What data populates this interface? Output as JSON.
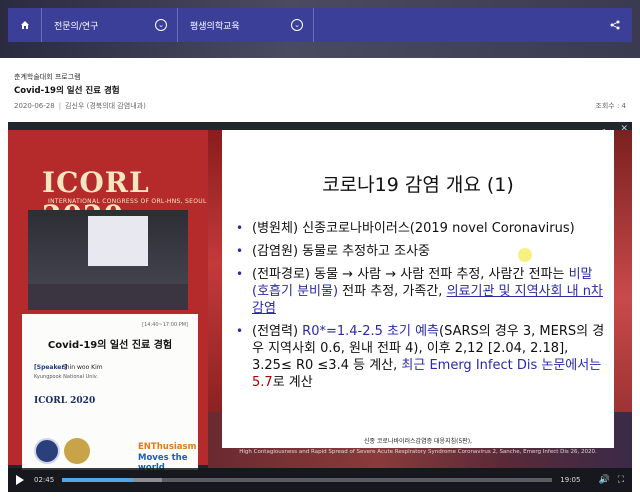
{
  "nav": {
    "home_icon": "home-icon",
    "menu1": "전문의/연구",
    "menu2": "평생의학교육",
    "share_icon": "share-icon",
    "bg_color": "#3b3f97"
  },
  "post": {
    "category": "춘계학술대회 프로그램",
    "title": "Covid-19의 일선 진료 경험",
    "date": "2020-06-28",
    "author": "김신우 (경북의대 감염내과)",
    "views_label": "조회수 : 4"
  },
  "video": {
    "current_time": "02:45",
    "duration": "19:05",
    "progress": 0.144,
    "buffered": 0.06,
    "left_panel": {
      "brand": "ICORL 2020",
      "brand_sub": "INTERNATIONAL CONGRESS OF ORL-HNS, SEOUL",
      "time": "[14:40~17:00 PM]",
      "talk_title": "Covid-19의 일선 진료 경험",
      "speaker_role": "[Speaker]",
      "speaker_name": "Shin woo Kim",
      "speaker_org": "Kyungpook National Univ.",
      "small_logo": "ICORL 2020",
      "tagline1": "ENThusiasm",
      "tagline2": "Moves the world"
    },
    "slide": {
      "heading": "코로나19 감염 개요 (1)",
      "b1_a": "(병원체) 신종코로나바이러스(2019 novel Coronavirus)",
      "b2_a": "(감염원) 동물로 추정하고 조사중",
      "b3_a": "(전파경로) 동물 → 사람 → 사람 전파 추정, 사람간 전파는 ",
      "b3_b": "비말(호흡기 분비물)",
      "b3_c": " 전파 추정, 가족간, ",
      "b3_d": "의료기관 및 지역사회 내 n차감염",
      "b4_a": "(전염력) ",
      "b4_b": "R0*=1.4-2.5 초기 예측",
      "b4_c": "(SARS의 경우 3, MERS의 경우 지역사회 0.6, 원내 전파 4), 이후 2,12 [2.04, 2.18], 3.25≤ R0 ≤3.4 등 계산, ",
      "b4_d": "최근 Emerg Infect Dis 논문에서는 ",
      "b4_e": "5.7",
      "b4_f": "로 계산",
      "caption1": "신종 코로나바이러스감염증 대응지침(5판),",
      "caption2": "High Contagiousness and Rapid Spread of Severe Acute Respiratory Syndrome Coronavirus 2, Sanche, Emerg Infect Dis 26, 2020."
    }
  }
}
